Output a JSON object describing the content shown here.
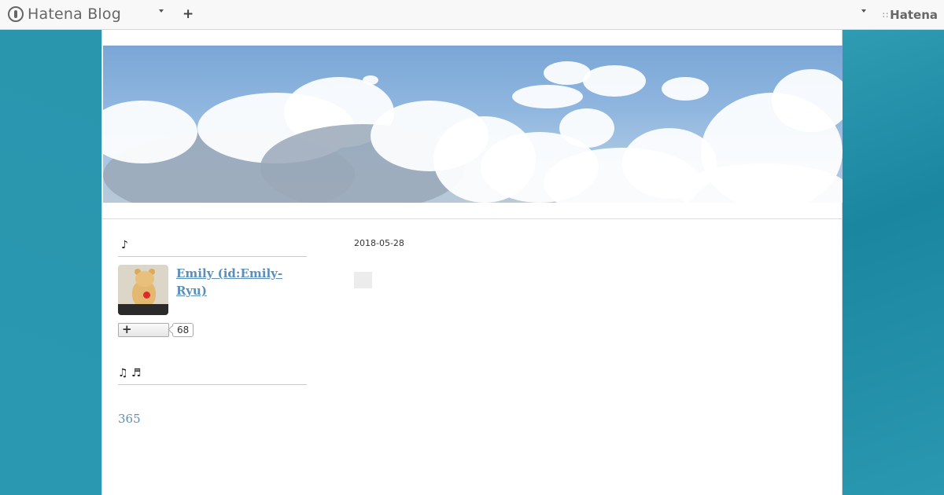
{
  "navbar": {
    "brand": "Hatena Blog",
    "hatena_mark": "∷",
    "hatena": "Hatena",
    "add_icon": "plus-icon"
  },
  "sidebar": {
    "profile_title": "♪",
    "profile_name": "Emily (id:Emily-Ryu)",
    "follow_symbol": "+",
    "follow_count": "68",
    "module2_title": "♫ ♬",
    "count_link": "365"
  },
  "main": {
    "entry_date": "2018-05-28"
  },
  "colors": {
    "background": "#2a96ae",
    "link": "#5b8fb9",
    "navbar": "#f8f8f8"
  }
}
